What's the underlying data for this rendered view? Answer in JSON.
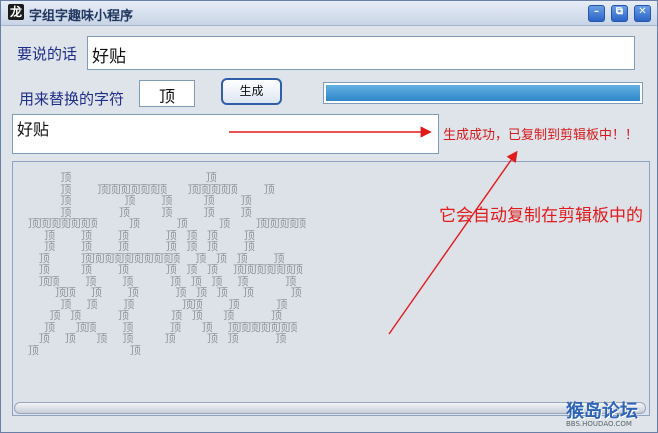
{
  "window": {
    "title": "字组字趣味小程序",
    "app_icon_glyph": "龙",
    "min_glyph": "–",
    "max_glyph": "⧉",
    "close_glyph": "✕"
  },
  "form": {
    "say_label": "要说的话",
    "say_value": "好贴",
    "replace_label": "用来替换的字符",
    "replace_value": "顶",
    "generate_label": "生成",
    "progress_fraction": 1.0
  },
  "output": {
    "value": "好贴",
    "status": "生成成功，已复制到剪辑板中！！"
  },
  "annotation": {
    "text": "它会自动复制在剪辑板中的"
  },
  "art_lines": [
    "        顶                         顶",
    "        顶     顶顶顶顶顶顶顶    顶顶顶顶顶     顶",
    "        顶          顶     顶      顶     顶",
    "        顶         顶      顶      顶     顶",
    "  顶顶顶顶顶顶顶      顶       顶      顶     顶顶顶顶顶",
    "     顶     顶     顶       顶  顶  顶     顶",
    "     顶     顶     顶       顶  顶  顶     顶",
    "    顶      顶顶顶顶顶顶顶顶顶顶   顶  顶  顶     顶",
    "    顶      顶     顶       顶  顶  顶   顶顶顶顶顶顶顶",
    "    顶顶     顶     顶       顶  顶  顶   顶       顶",
    "       顶顶   顶     顶       顶  顶  顶   顶       顶",
    "        顶   顶     顶         顶顶     顶       顶",
    "      顶  顶       顶        顶  顶    顶       顶",
    "     顶    顶顶     顶       顶    顶   顶顶顶顶顶顶顶",
    "    顶   顶    顶   顶      顶      顶  顶       顶",
    "  顶                 顶"
  ],
  "watermark": {
    "logo": "猴岛论坛",
    "url": "BBS.HOUDAO.COM"
  }
}
